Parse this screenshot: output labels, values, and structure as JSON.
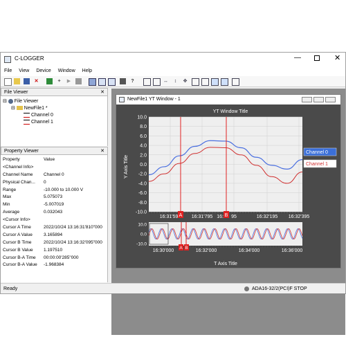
{
  "app": {
    "title": "C-LOGGER"
  },
  "menu": [
    "File",
    "View",
    "Device",
    "Window",
    "Help"
  ],
  "file_viewer": {
    "title": "File Viewer",
    "root": "File Viewer",
    "file": "NewFile1 *",
    "channels": [
      "Channel 0",
      "Channel 1"
    ]
  },
  "property_viewer": {
    "title": "Property Viewer",
    "col_property": "Property",
    "col_value": "Value",
    "rows": [
      [
        "<Channel Info>",
        ""
      ],
      [
        "Channel Name",
        "Channel 0"
      ],
      [
        "Physical Chan...",
        "0"
      ],
      [
        "Range",
        "-10.000 to 10.000 V"
      ],
      [
        "Max",
        "5.075073"
      ],
      [
        "Min",
        "-5.007019"
      ],
      [
        "Average",
        "0.032043"
      ],
      [
        "<Cursor Info>",
        ""
      ],
      [
        "Cursor A Time",
        "2022/10/24 13:16:31'810\"000"
      ],
      [
        "Cursor A Value",
        "3.165894"
      ],
      [
        "Cursor B Time",
        "2022/10/24 13:16:32'095\"000"
      ],
      [
        "Cursor B Value",
        "1.197510"
      ],
      [
        "Cursor B-A Time",
        "00:00:00'285\"000"
      ],
      [
        "Cursor B-A Value",
        "-1.968384"
      ]
    ]
  },
  "yt_window": {
    "title": "NewFile1 YT Window - 1",
    "chart_title": "YT Window Title",
    "y_axis_title": "Y Axis Title",
    "t_axis_title": "T Axis Title",
    "y_ticks": [
      "10.0",
      "8.0",
      "6.0",
      "4.0",
      "2.0",
      "0.0",
      "-2.0",
      "-4.0",
      "-6.0",
      "-8.0",
      "-10.0"
    ],
    "top_x_ticks": [
      "16:31'595",
      "16:31'795",
      "16:3",
      "95",
      "16:32'195",
      "16:32'395"
    ],
    "overview_y_ticks": [
      "10.0",
      "0.0",
      "-10.0"
    ],
    "overview_x_ticks": [
      "16:30'000",
      "16:32'000",
      "16:34'000",
      "16:36'000"
    ],
    "cursor_a": "A",
    "cursor_b": "B",
    "legend": [
      "Channel 0",
      "Channel 1"
    ],
    "colors": {
      "channel0": "#4a6fe0",
      "channel1": "#d03030",
      "cursor": "#e02020",
      "legend_active": "#3b6fd8"
    }
  },
  "chart_data": {
    "type": "line",
    "title": "YT Window Title",
    "xlabel": "T Axis Title",
    "ylabel": "Y Axis Title",
    "ylim": [
      -10,
      10
    ],
    "x_tick_labels": [
      "16:31'595",
      "16:31'795",
      "16:31'995",
      "16:32'195",
      "16:32'395"
    ],
    "x": [
      "16:31'500",
      "16:31'600",
      "16:31'700",
      "16:31'800",
      "16:31'900",
      "16:32'000",
      "16:32'100",
      "16:32'200",
      "16:32'300",
      "16:32'400",
      "16:32'500"
    ],
    "series": [
      {
        "name": "Channel 0",
        "values": [
          -2.2,
          -0.5,
          1.8,
          3.8,
          5.0,
          4.9,
          3.5,
          1.5,
          -0.2,
          -1.0,
          1.0
        ]
      },
      {
        "name": "Channel 1",
        "values": [
          -3.6,
          -2.0,
          0.2,
          2.3,
          3.6,
          3.5,
          2.0,
          -0.2,
          -2.6,
          -4.0,
          -1.6
        ]
      }
    ],
    "cursors": {
      "A": "16:31'810",
      "B": "16:32'095"
    }
  },
  "status": {
    "left": "Ready",
    "right": "ADA16-32/2(PCI)F STOP"
  }
}
